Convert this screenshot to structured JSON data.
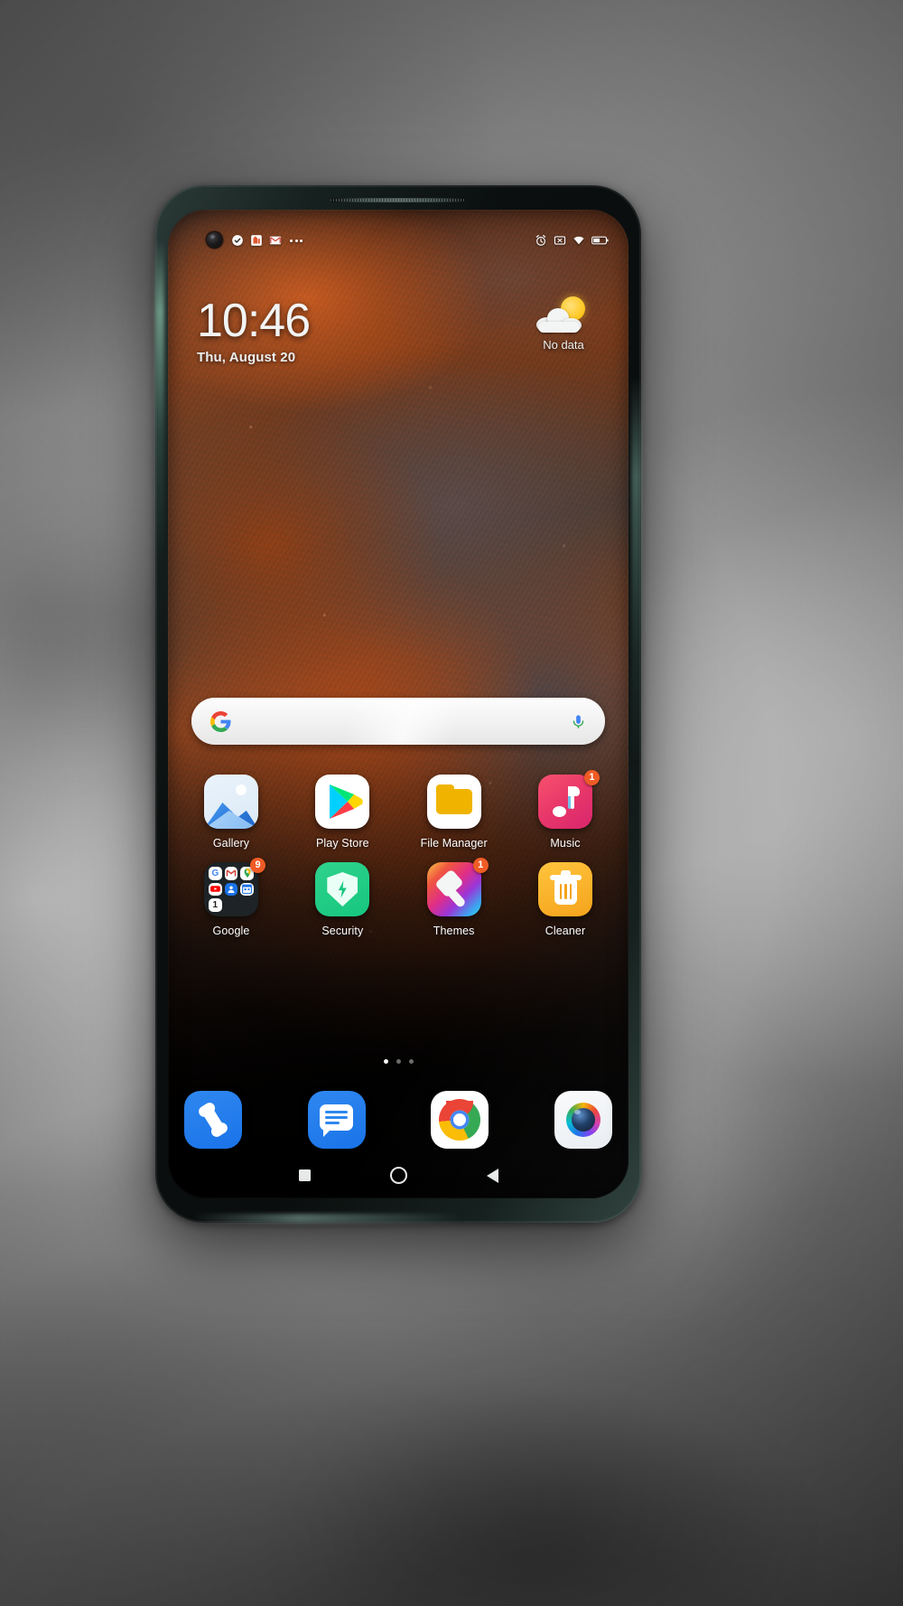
{
  "device": {
    "type": "smartphone",
    "os": "MIUI Android home screen",
    "frame_color": "#16211f"
  },
  "status_bar": {
    "left_icons": [
      {
        "name": "checkmark-circle-icon",
        "glyph": "check"
      },
      {
        "name": "app-notification-icon",
        "glyph": "app"
      },
      {
        "name": "gmail-icon",
        "glyph": "mail"
      },
      {
        "name": "more-notifications-icon",
        "glyph": "dots"
      }
    ],
    "right_icons": [
      {
        "name": "alarm-icon",
        "glyph": "alarm"
      },
      {
        "name": "silent-mode-icon",
        "glyph": "mute"
      },
      {
        "name": "wifi-icon",
        "glyph": "wifi"
      },
      {
        "name": "battery-icon",
        "glyph": "battery"
      }
    ]
  },
  "clock_widget": {
    "time": "10:46",
    "date": "Thu, August 20"
  },
  "weather_widget": {
    "status": "No data",
    "icon": "sun-behind-cloud-icon"
  },
  "search_bar": {
    "logo": "google-g-icon",
    "placeholder": "",
    "value": "",
    "mic": "microphone-icon"
  },
  "app_grid": {
    "rows": [
      [
        {
          "label": "Gallery",
          "icon": "gallery-icon",
          "badge": ""
        },
        {
          "label": "Play Store",
          "icon": "play-store-icon",
          "badge": ""
        },
        {
          "label": "File Manager",
          "icon": "file-manager-icon",
          "badge": ""
        },
        {
          "label": "Music",
          "icon": "music-icon",
          "badge": "1"
        }
      ],
      [
        {
          "label": "Google",
          "icon": "google-folder-icon",
          "badge": "9"
        },
        {
          "label": "Security",
          "icon": "security-icon",
          "badge": ""
        },
        {
          "label": "Themes",
          "icon": "themes-icon",
          "badge": "1"
        },
        {
          "label": "Cleaner",
          "icon": "cleaner-icon",
          "badge": ""
        }
      ]
    ],
    "google_folder_apps": [
      "G",
      "M",
      "Maps",
      "YT",
      "Contacts",
      "Cal",
      "1"
    ]
  },
  "page_indicator": {
    "total": 3,
    "active": 1
  },
  "dock": [
    {
      "name": "phone-app",
      "icon": "phone-icon"
    },
    {
      "name": "messages-app",
      "icon": "messages-icon"
    },
    {
      "name": "chrome-app",
      "icon": "chrome-icon"
    },
    {
      "name": "camera-app",
      "icon": "camera-icon"
    }
  ],
  "nav_bar": [
    {
      "name": "recents-button",
      "icon": "square-icon"
    },
    {
      "name": "home-button",
      "icon": "circle-icon"
    },
    {
      "name": "back-button",
      "icon": "triangle-left-icon"
    }
  ],
  "colors": {
    "badge": "#ef5b25",
    "accent_blue": "#1a73e8",
    "security_green": "#16c77f",
    "cleaner_yellow": "#f5a21a"
  }
}
